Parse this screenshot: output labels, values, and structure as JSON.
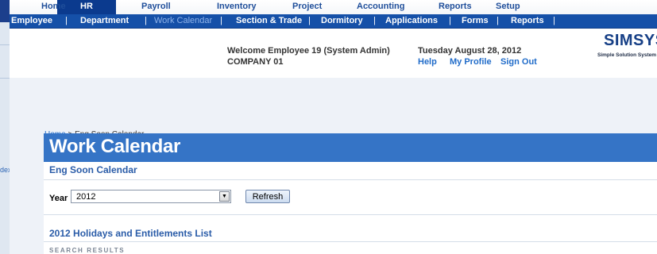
{
  "background": {
    "partial_text": "dex"
  },
  "topnav": {
    "items": [
      "Home",
      "HR",
      "Payroll",
      "Inventory",
      "Project",
      "Accounting",
      "Reports",
      "Setup"
    ],
    "active": "HR"
  },
  "subnav": {
    "items": [
      "Employee",
      "Department",
      "Work Calendar",
      "Section & Trade",
      "Dormitory",
      "Applications",
      "Forms",
      "Reports"
    ],
    "current": "Work Calendar"
  },
  "header": {
    "welcome": "Welcome Employee 19 (System Admin)",
    "company": "COMPANY 01",
    "date": "Tuesday August 28, 2012",
    "links": {
      "help": "Help",
      "profile": "My Profile",
      "signout": "Sign Out"
    }
  },
  "logo": {
    "brand": "SIMSYS",
    "tagline": "Simple Solution System"
  },
  "breadcrumb": {
    "home": "Home",
    "separator": ">",
    "current": "Eng Soon Calendar"
  },
  "page": {
    "title": "Work Calendar",
    "subtitle": "Eng Soon Calendar",
    "year_label": "Year",
    "year_value": "2012",
    "refresh_label": "Refresh",
    "list_title": "2012  Holidays and Entitlements List",
    "search_results": "SEARCH RESULTS"
  },
  "colors": {
    "nav_active": "#0b3a8e",
    "subnav_bg": "#1550a8",
    "title_bar": "#3574c6",
    "link": "#1f6bc9",
    "content_bg": "#eef2f8"
  }
}
